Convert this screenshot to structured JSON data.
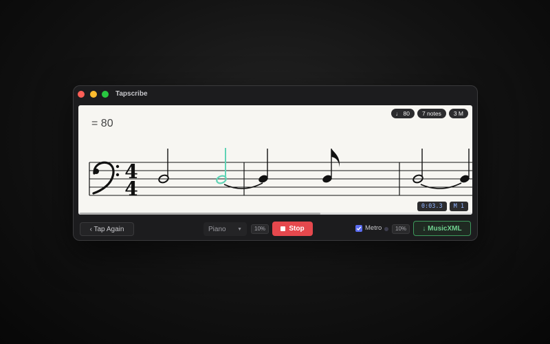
{
  "window": {
    "title": "Tapscribe"
  },
  "score": {
    "tempo_text": "= 80",
    "badges": [
      {
        "label": "♩ 80"
      },
      {
        "label": "7 notes"
      },
      {
        "label": "3 M"
      }
    ],
    "position": {
      "time": "0:03.3",
      "measure": "M 1"
    },
    "clef": "bass",
    "time_signature": {
      "top": "4",
      "bottom": "4"
    },
    "note_color": "#111111",
    "highlight_color": "#5fd3b5",
    "scroll_fraction": 0.61
  },
  "toolbar": {
    "tap_again_label": "‹ Tap Again",
    "instrument": "Piano",
    "volume_left": "10%",
    "stop_label": "Stop",
    "metro_label": "Metro",
    "metro_checked": true,
    "volume_right": "10%",
    "export_label": "↓ MusicXML",
    "stop_color": "#e5484d",
    "export_color": "#6fd08f"
  }
}
